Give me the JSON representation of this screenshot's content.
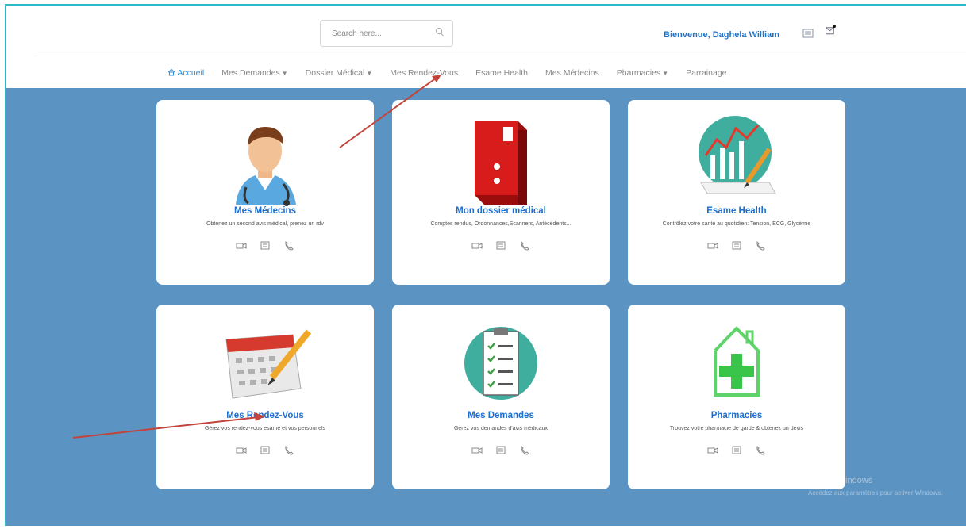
{
  "header": {
    "search_placeholder": "Search here...",
    "welcome": "Bienvenue, Daghela William"
  },
  "nav": {
    "items": [
      {
        "label": "Accueil",
        "active": true
      },
      {
        "label": "Mes Demandes",
        "dropdown": true
      },
      {
        "label": "Dossier Médical",
        "dropdown": true
      },
      {
        "label": "Mes Rendez-Vous"
      },
      {
        "label": "Esame Health"
      },
      {
        "label": "Mes Médecins"
      },
      {
        "label": "Pharmacies",
        "dropdown": true
      },
      {
        "label": "Parrainage"
      }
    ]
  },
  "cards": [
    {
      "title": "Mes Médecins",
      "desc": "Obtenez un second avis médical, prenez un rdv",
      "icon": "doctor-icon"
    },
    {
      "title": "Mon dossier médical",
      "desc": "Comptes rendus, Ordonnances,Scanners, Antécédents...",
      "icon": "red-binder-icon"
    },
    {
      "title": "Esame Health",
      "desc": "Contrôlez votre santé au quotidien: Tension, ECG, Glycémie",
      "icon": "health-chart-icon"
    },
    {
      "title": "Mes Rendez-Vous",
      "desc": "Gérez vos rendez-vous esame et vos personnels",
      "icon": "calendar-icon"
    },
    {
      "title": "Mes Demandes",
      "desc": "Gérez vos demandes d'avis médicaux",
      "icon": "checklist-icon"
    },
    {
      "title": "Pharmacies",
      "desc": "Trouvez votre pharmacie de garde & obtenez un devis",
      "icon": "pharmacy-icon"
    }
  ],
  "watermark": {
    "line1": "Activer Windows",
    "line2": "Accédez aux paramètres pour activer Windows."
  }
}
